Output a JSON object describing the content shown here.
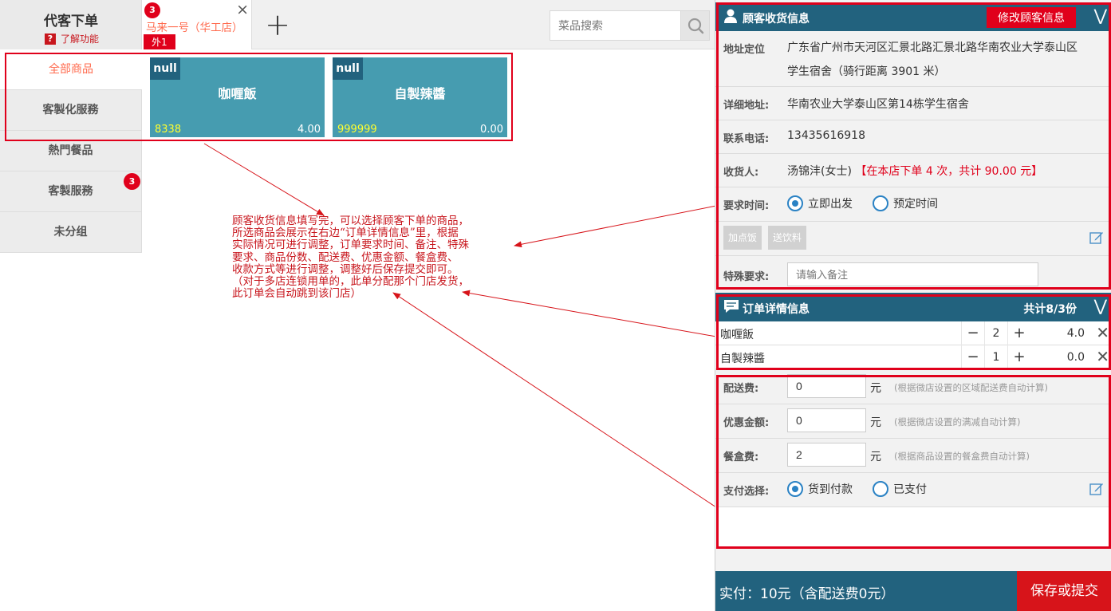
{
  "header": {
    "title": "代客下单",
    "help_label": "了解功能",
    "help_icon": "?",
    "shop_tab": {
      "badge": "3",
      "name": "马来一号（华工店）",
      "tag": "外1",
      "close": "×"
    },
    "add_tab": "+",
    "search": {
      "placeholder": "菜品搜索"
    }
  },
  "sidebar": {
    "items": [
      {
        "label": "全部商品"
      },
      {
        "label": "客製化服務"
      },
      {
        "label": "熱門餐品"
      },
      {
        "label": "客製服務"
      },
      {
        "label": "未分组"
      }
    ],
    "badge": "3"
  },
  "products": [
    {
      "tag": "null",
      "name": "咖喱飯",
      "code": "8338",
      "price": "4.00"
    },
    {
      "tag": "null",
      "name": "自製辣醬",
      "code": "999999",
      "price": "0.00"
    }
  ],
  "annotation": {
    "lines": [
      "顾客收货信息填写完，可以选择顾客下单的商品，",
      "所选商品会展示在右边“订单详情信息”里，根据",
      "实际情况可进行调整，订单要求时间、备注、特殊",
      "要求、商品份数、配送费、优惠金额、餐盒费、",
      "收款方式等进行调整，调整好后保存提交即可。",
      "（对于多店连锁用单的，此单分配那个门店发货，",
      "此订单会自动跳到该门店）"
    ]
  },
  "customer": {
    "title": "顾客收货信息",
    "edit_label": "修改顾客信息",
    "chevron": "⋁",
    "address_label": "地址定位",
    "address_line1": "广东省广州市天河区汇景北路汇景北路华南农业大学泰山区",
    "address_line2": "学生宿舍（骑行距离 3901 米）",
    "detail_label": "详细地址:",
    "detail_value": "华南农业大学泰山区第14栋学生宿舍",
    "phone_label": "联系电话:",
    "phone_value": "13435616918",
    "receiver_label": "收货人:",
    "receiver_value": "汤锦沣(女士)",
    "receiver_note": "【在本店下单 4 次，共计 90.00 元】",
    "time_label": "要求时间:",
    "time_options": [
      "立即出发",
      "预定时间"
    ],
    "chips": [
      "加点饭",
      "送饮料"
    ],
    "special_label": "特殊要求:",
    "special_placeholder": "请输入备注"
  },
  "order": {
    "title": "订单详情信息",
    "summary": "共计8/3份",
    "items": [
      {
        "name": "咖喱飯",
        "qty": "2",
        "value": "4.0"
      },
      {
        "name": "自製辣醬",
        "qty": "1",
        "value": "0.0"
      }
    ],
    "minus": "−",
    "plus": "+",
    "remove": "✕"
  },
  "fees": {
    "delivery_label": "配送费:",
    "delivery_value": "0",
    "delivery_hint": "(根据微店设置的区域配送费自动计算)",
    "discount_label": "优惠金额:",
    "discount_value": "0",
    "discount_hint": "(根据微店设置的满减自动计算)",
    "box_label": "餐盒费:",
    "box_value": "2",
    "box_hint": "(根据商品设置的餐盒费自动计算)",
    "unit": "元",
    "pay_label": "支付选择:",
    "pay_options": [
      "货到付款",
      "已支付"
    ]
  },
  "footer": {
    "total": "实付：10元（含配送费0元）",
    "submit_label": "保存或提交"
  },
  "colors": {
    "accent_red": "#e0001b",
    "header_blue": "#22627e",
    "product_teal": "#469cb0",
    "radio_blue": "#2a82c4"
  }
}
